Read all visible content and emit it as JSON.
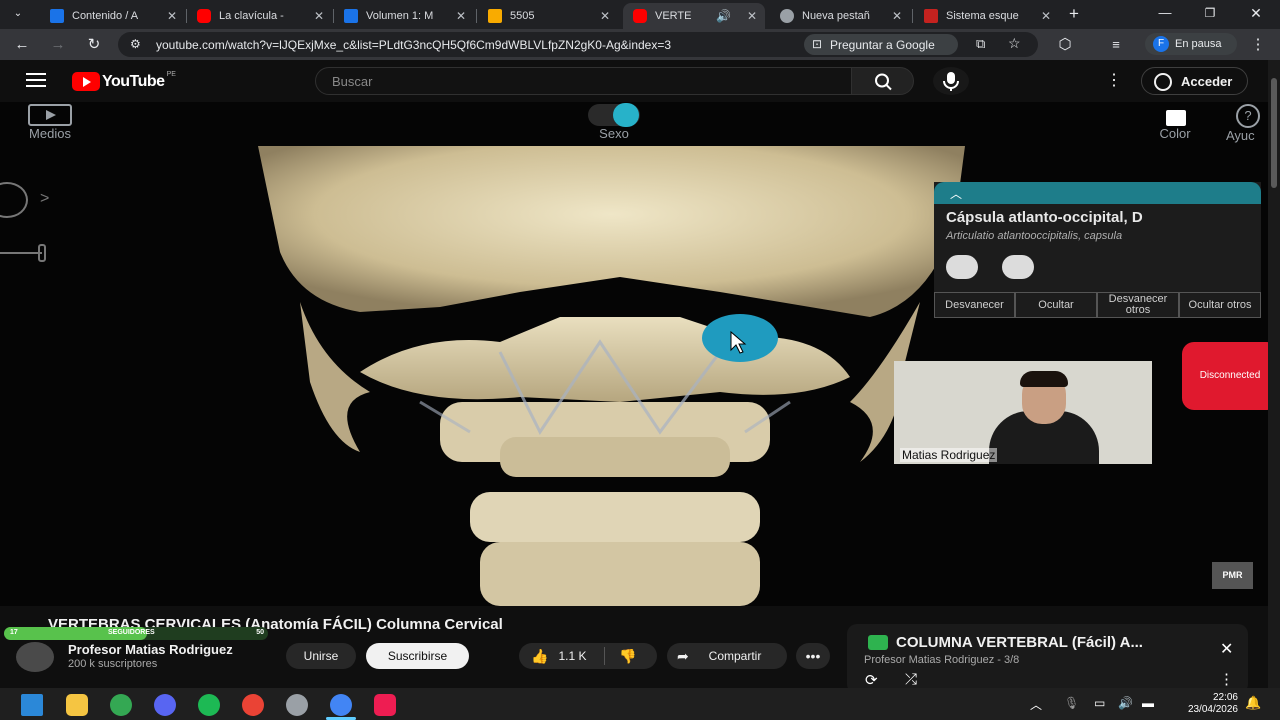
{
  "tabs": [
    {
      "title": "Contenido / A",
      "favicon_color": "#1a73e8",
      "icon": "atlas-icon"
    },
    {
      "title": "La clavícula -",
      "favicon_color": "#ff0000",
      "icon": "youtube-icon"
    },
    {
      "title": "Volumen 1: M",
      "favicon_color": "#1a73e8",
      "icon": "atlas-icon"
    },
    {
      "title": "5505",
      "favicon_color": "#f9ab00",
      "icon": "shield-icon"
    },
    {
      "title": "VERTE",
      "favicon_color": "#ff0000",
      "icon": "youtube-icon",
      "active": true
    },
    {
      "title": "Nueva pestañ",
      "favicon_color": "#9aa0a6",
      "icon": "chrome-icon"
    },
    {
      "title": "Sistema esque",
      "favicon_color": "#c5221f",
      "icon": "doc-icon"
    }
  ],
  "browser": {
    "url": "youtube.com/watch?v=lJQExjMxe_c&list=PLdtG3ncQH5Qf6Cm9dWBLVLfpZN2gK0-Ag&index=3",
    "ask_google": "Preguntar a Google",
    "profile_initial": "F",
    "profile_status": "En pausa"
  },
  "youtube": {
    "logo": "YouTube",
    "country": "PE",
    "search_placeholder": "Buscar",
    "signin": "Acceder"
  },
  "viewer": {
    "media_label": "Medios",
    "sex_label": "Sexo",
    "color_label": "Color",
    "help_label": "Ayuc",
    "info_title": "Cápsula atlanto-occipital, D",
    "info_subtitle": "Articulatio atlantooccipitalis, capsula",
    "buttons": [
      "Desvanecer",
      "Ocultar",
      "Desvanecer otros",
      "Ocultar otros"
    ],
    "webcam_name": "Matias Rodriguez",
    "disconnected": "Disconnected",
    "watermark": "PMR"
  },
  "video": {
    "title": "VERTEBRAS CERVICALES (Anatomía FÁCIL) Columna Cervical",
    "followers_label": "SEGUIDORES",
    "followers_left": "17",
    "followers_right": "50",
    "channel": "Profesor Matias Rodriguez",
    "subscribers": "200 k suscriptores",
    "join": "Unirse",
    "subscribe": "Suscribirse",
    "likes": "1.1 K",
    "share": "Compartir"
  },
  "playlist": {
    "title": "COLUMNA VERTEBRAL (Fácil) A...",
    "subtitle": "Profesor Matias Rodriguez - 3/8"
  },
  "taskbar": {
    "time": "22:06",
    "date": "23/04/2026"
  }
}
